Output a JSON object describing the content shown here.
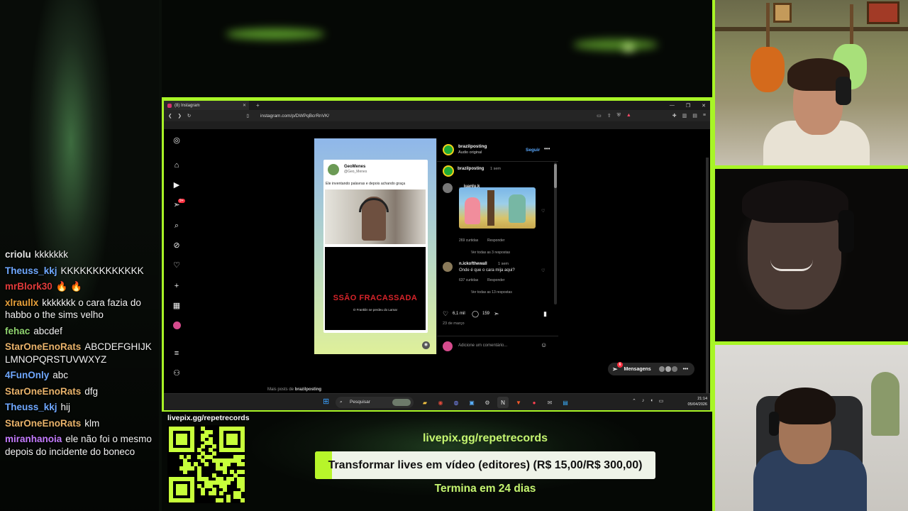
{
  "chat": [
    {
      "user": "criolu",
      "color": "#e4e4e4",
      "text": "kkkkkkk"
    },
    {
      "user": "Theuss_kkj",
      "color": "#6fa8ff",
      "text": "KKKKKKKKKKKKK"
    },
    {
      "user": "mrBlork30",
      "color": "#e23b3b",
      "text": "🔥 🔥"
    },
    {
      "user": "xlraullx",
      "color": "#e6a03a",
      "text": "kkkkkkk o cara fazia do habbo o the sims velho"
    },
    {
      "user": "fehac",
      "color": "#8fd36e",
      "text": "abcdef"
    },
    {
      "user": "StarOneEnoRats",
      "color": "#e8b26a",
      "text": "ABCDEFGHIJKLMNOPQRSTUVWXYZ"
    },
    {
      "user": "4FunOnly",
      "color": "#6fa8ff",
      "text": "abc"
    },
    {
      "user": "StarOneEnoRats",
      "color": "#e8b26a",
      "text": "dfg"
    },
    {
      "user": "Theuss_kkj",
      "color": "#6fa8ff",
      "text": "hij"
    },
    {
      "user": "StarOneEnoRats",
      "color": "#e8b26a",
      "text": "klm"
    },
    {
      "user": "miranhanoia",
      "color": "#c47bff",
      "text": "ele não foi o mesmo depois do incidente do boneco"
    }
  ],
  "browser": {
    "tab_title": "(8) Instagram",
    "url": "instagram.com/p/DWPqBcrRnVK/"
  },
  "post": {
    "tweet_name": "GeoMenes",
    "tweet_handle": "@Geo_Menes",
    "tweet_text": "Ele inventando palavras e depois achando graça",
    "video_overlay": "SSÃO FRACASSADA",
    "video_subtitle": "O Franklin se perdeu do Lamar",
    "account": "brazilposting",
    "audio": "Áudio original",
    "follow": "Seguir",
    "caption_user": "brazilposting",
    "caption_time": "1 sem",
    "comment1_user": "__juanlu.k",
    "comment1_likes": "269 curtidas",
    "comment1_reply": "Responder",
    "comment1_view": "Ver todas as 3 respostas",
    "comment2_user": "n.ickofthewall",
    "comment2_time": "1 sem",
    "comment2_text": "Onde é que o cara mija aqui?",
    "comment2_likes": "637 curtidas",
    "comment2_reply": "Responder",
    "comment2_view": "Ver todas as 13 respostas",
    "likes": "6,1 mil",
    "comments": "159",
    "date": "23 de março",
    "add_comment": "Adicione um comentário...",
    "more_posts_prefix": "Mais posts de",
    "more_posts_user": "brazilposting",
    "messages": "Mensagens",
    "messages_badge": "6",
    "notifications_badge": "9+"
  },
  "taskbar": {
    "search": "Pesquisar",
    "time": "21:14",
    "date": "05/04/2026"
  },
  "donation": {
    "qr_label": "livepix.gg/repetrecords",
    "url": "livepix.gg/repetrecords",
    "goal_text": "Transformar lives em vídeo (editores) (R$ 15,00/R$ 300,00)",
    "goal_fraction": 0.05,
    "ends": "Termina em 24 dias"
  },
  "colors": {
    "frame_green": "#a8f526",
    "donation_green": "#c5f570",
    "goal_fill": "#b7f52a",
    "instagram_blue": "#5aa9ff"
  }
}
